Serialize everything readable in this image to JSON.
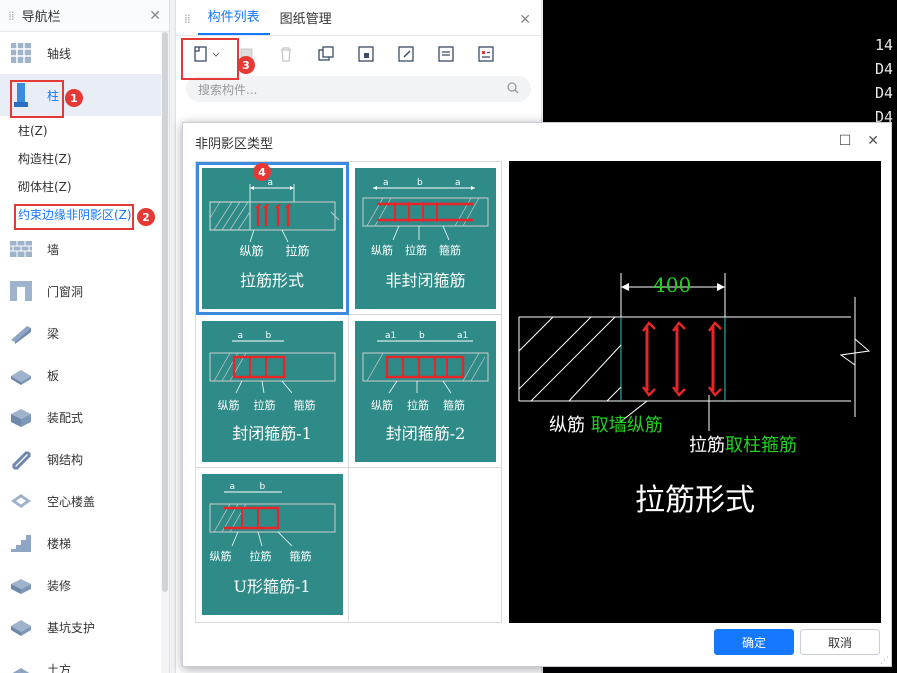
{
  "nav": {
    "title": "导航栏",
    "items": [
      {
        "label": "轴线",
        "icon": "axis-grid-icon"
      },
      {
        "label": "柱",
        "icon": "column-icon"
      },
      {
        "label": "墙",
        "icon": "wall-icon"
      },
      {
        "label": "门窗洞",
        "icon": "door-window-icon"
      },
      {
        "label": "梁",
        "icon": "beam-icon"
      },
      {
        "label": "板",
        "icon": "slab-icon"
      },
      {
        "label": "装配式",
        "icon": "prefab-icon"
      },
      {
        "label": "钢结构",
        "icon": "steel-icon"
      },
      {
        "label": "空心楼盖",
        "icon": "hollow-floor-icon"
      },
      {
        "label": "楼梯",
        "icon": "stair-icon"
      },
      {
        "label": "装修",
        "icon": "decoration-icon"
      },
      {
        "label": "基坑支护",
        "icon": "pit-support-icon"
      },
      {
        "label": "土方",
        "icon": "earthwork-icon"
      }
    ],
    "sub_items": [
      "柱(Z)",
      "构造柱(Z)",
      "砌体柱(Z)",
      "约束边缘非阴影区(Z)"
    ]
  },
  "mid": {
    "tabs": [
      "构件列表",
      "图纸管理"
    ],
    "search_placeholder": "搜索构件..."
  },
  "cad": {
    "texts": [
      "14",
      "D4",
      "D4",
      "D4"
    ]
  },
  "annotations": [
    "1",
    "2",
    "3",
    "4"
  ],
  "dialog": {
    "title": "非阴影区类型",
    "cards": [
      {
        "name": "拉筋形式",
        "labels": [
          "纵筋",
          "拉筋"
        ],
        "dims": [
          "a"
        ]
      },
      {
        "name": "非封闭箍筋",
        "labels": [
          "纵筋",
          "拉筋",
          "箍筋"
        ],
        "dims": [
          "a",
          "b",
          "a"
        ]
      },
      {
        "name": "封闭箍筋-1",
        "labels": [
          "纵筋",
          "拉筋",
          "箍筋"
        ],
        "dims": [
          "a",
          "b"
        ]
      },
      {
        "name": "封闭箍筋-2",
        "labels": [
          "纵筋",
          "拉筋",
          "箍筋"
        ],
        "dims": [
          "a1",
          "b",
          "a1"
        ]
      },
      {
        "name": "U形箍筋-1",
        "labels": [
          "纵筋",
          "拉筋",
          "箍筋"
        ],
        "dims": [
          "a",
          "b"
        ]
      }
    ],
    "preview": {
      "dimension": "400",
      "label1_prefix": "纵筋",
      "label1_value": "取墙纵筋",
      "label2_prefix": "拉筋",
      "label2_value": "取柱箍筋",
      "caption": "拉筋形式"
    },
    "ok_label": "确定",
    "cancel_label": "取消",
    "colors": {
      "card_bg": "#2e8b87",
      "accent": "#1677ff",
      "rebar": "#e8262a",
      "cad_green": "#22d11f"
    }
  }
}
